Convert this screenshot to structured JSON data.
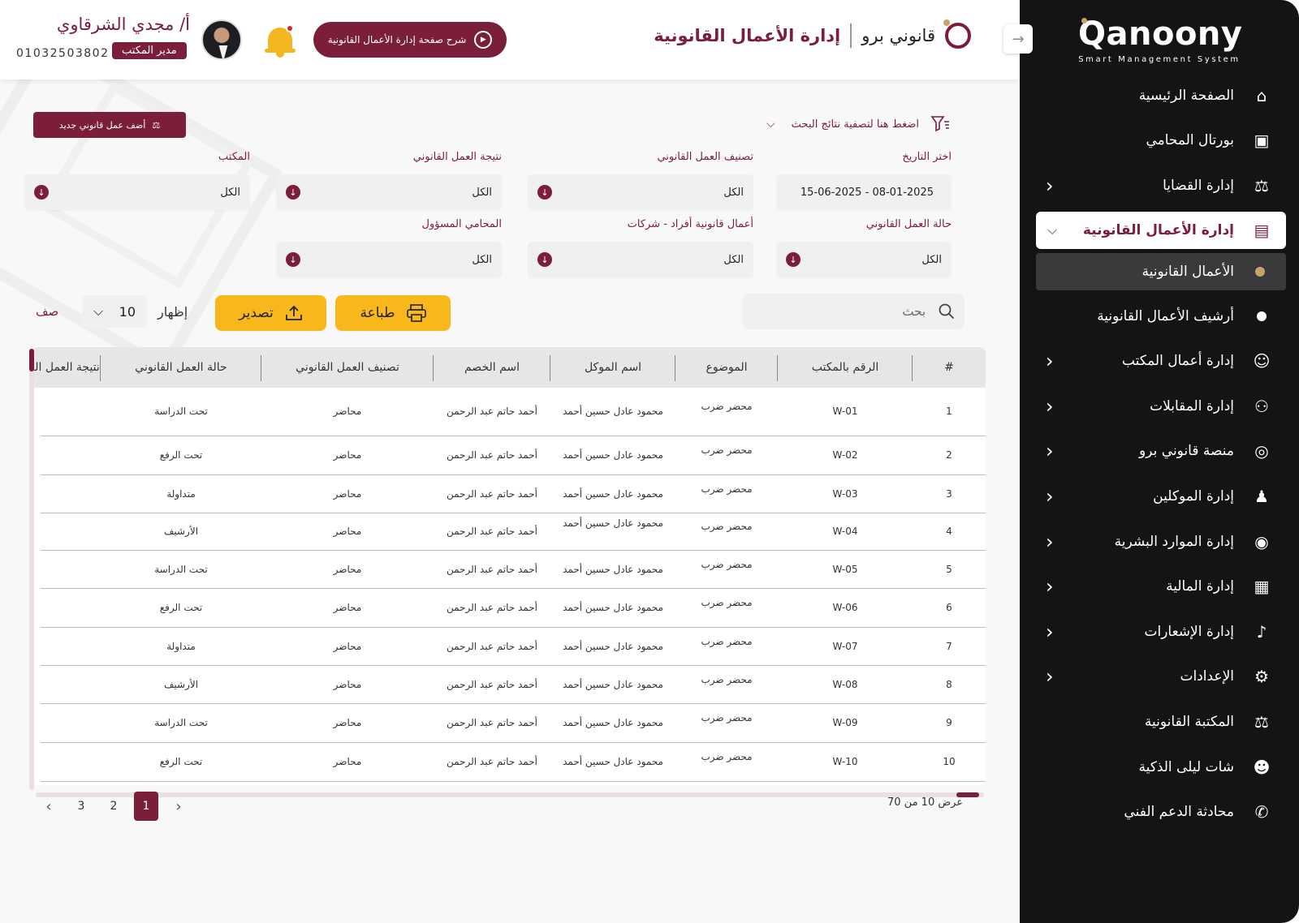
{
  "brand": {
    "logo": "Qanoony",
    "subtitle": "Smart Management System"
  },
  "header": {
    "app_name": "قانوني برو",
    "page_title": "إدارة الأعمال القانونية",
    "explain_button": "شرح صفحة إدارة الأعمال القانونية",
    "user_name": "أ/ مجدي الشرقاوي",
    "user_role": "مدير المكتب",
    "user_phone": "01032503802"
  },
  "sidebar": {
    "items": [
      {
        "label": "الصفحة الرئيسية",
        "icon": "home-icon",
        "glyph": "⌂"
      },
      {
        "label": "بورتال المحامي",
        "icon": "briefcase-icon",
        "glyph": "▣"
      },
      {
        "label": "إدارة القضايا",
        "icon": "scales-icon",
        "glyph": "⚖"
      },
      {
        "label": "إدارة الأعمال القانونية",
        "icon": "legal-docs-icon",
        "glyph": "▤"
      },
      {
        "label": "الأعمال القانونية",
        "icon": "bullet-icon"
      },
      {
        "label": "أرشيف الأعمال القانونية",
        "icon": "bullet-icon"
      },
      {
        "label": "إدارة أعمال المكتب",
        "icon": "office-icon",
        "glyph": "☺"
      },
      {
        "label": "إدارة المقابلات",
        "icon": "meetings-icon",
        "glyph": "⚇"
      },
      {
        "label": "منصة قانوني برو",
        "icon": "platform-icon",
        "glyph": "◎"
      },
      {
        "label": "إدارة الموكلين",
        "icon": "client-icon",
        "glyph": "♟"
      },
      {
        "label": "إدارة الموارد البشرية",
        "icon": "hr-icon",
        "glyph": "◉"
      },
      {
        "label": "إدارة المالية",
        "icon": "finance-icon",
        "glyph": "▦"
      },
      {
        "label": "إدارة الإشعارات",
        "icon": "bell-icon",
        "glyph": "♪"
      },
      {
        "label": "الإعدادات",
        "icon": "gear-icon",
        "glyph": "⚙"
      },
      {
        "label": "المكتبة القانونية",
        "icon": "library-icon",
        "glyph": "⚖"
      },
      {
        "label": "شات ليلى الذكية",
        "icon": "ai-chat-icon",
        "glyph": "☻"
      },
      {
        "label": "محادثة الدعم الفني",
        "icon": "support-icon",
        "glyph": "✆"
      }
    ]
  },
  "toolbar": {
    "add_button": "أضف عمل قانوني جديد",
    "filter_toggle": "اضغط هنا لتصفية نتائج البحث"
  },
  "filters": {
    "date_label": "اختر التاريخ",
    "date_value": "08-01-2025 - 15-06-2025",
    "classification_label": "تصنيف العمل القانوني",
    "classification_value": "الكل",
    "result_label": "نتيجة العمل القانوني",
    "result_value": "الكل",
    "office_label": "المكتب",
    "office_value": "الكل",
    "status_label": "حالة العمل القانوني",
    "status_value": "الكل",
    "type_label": "أعمال قانونية أفراد - شركات",
    "type_value": "الكل",
    "lawyer_label": "المحامي المسؤول",
    "lawyer_value": "الكل"
  },
  "actions": {
    "search_placeholder": "بحث",
    "print": "طباعة",
    "export": "تصدير",
    "show_label": "إظهار",
    "page_size": "10",
    "rows_label": "صف"
  },
  "table": {
    "headers": [
      "#",
      "الرقم بالمكتب",
      "الموضوع",
      "اسم الموكل",
      "اسم الخصم",
      "تصنيف العمل القانوني",
      "حالة العمل القانوني",
      "نتيجة العمل القانوني"
    ],
    "rows": [
      [
        "1",
        "W-01",
        "محضر ضرب",
        "محمود عادل حسين أحمد",
        "أحمد حاتم عبد الرحمن",
        "محاضر",
        "تحت الدراسة"
      ],
      [
        "2",
        "W-02",
        "محضر ضرب",
        "محمود عادل حسين أحمد",
        "أحمد حاتم عبد الرحمن",
        "محاضر",
        "تحت الرفع"
      ],
      [
        "3",
        "W-03",
        "محضر ضرب",
        "محمود عادل حسين أحمد",
        "أحمد حاتم عبد الرحمن",
        "محاضر",
        "متداولة"
      ],
      [
        "4",
        "W-04",
        "محضر ضرب",
        "محمود عادل حسين أحمد",
        "أحمد حاتم عبد الرحمن",
        "محاضر",
        "الأرشيف"
      ],
      [
        "5",
        "W-05",
        "محضر ضرب",
        "محمود عادل حسين أحمد",
        "أحمد حاتم عبد الرحمن",
        "محاضر",
        "تحت الدراسة"
      ],
      [
        "6",
        "W-06",
        "محضر ضرب",
        "محمود عادل حسين أحمد",
        "أحمد حاتم عبد الرحمن",
        "محاضر",
        "تحت الرفع"
      ],
      [
        "7",
        "W-07",
        "محضر ضرب",
        "محمود عادل حسين أحمد",
        "أحمد حاتم عبد الرحمن",
        "محاضر",
        "متداولة"
      ],
      [
        "8",
        "W-08",
        "محضر ضرب",
        "محمود عادل حسين أحمد",
        "أحمد حاتم عبد الرحمن",
        "محاضر",
        "الأرشيف"
      ],
      [
        "9",
        "W-09",
        "محضر ضرب",
        "محمود عادل حسين أحمد",
        "أحمد حاتم عبد الرحمن",
        "محاضر",
        "تحت الدراسة"
      ],
      [
        "10",
        "W-10",
        "محضر ضرب",
        "محمود عادل حسين أحمد",
        "أحمد حاتم عبد الرحمن",
        "محاضر",
        "تحت الرفع"
      ]
    ]
  },
  "pagination": {
    "summary": "عرض 10 من 70",
    "pages": [
      "1",
      "2",
      "3"
    ],
    "current": "1"
  },
  "colors": {
    "primary": "#7a1e3a",
    "accent": "#f8b81c",
    "sidebar": "#141414",
    "gold": "#c9a46a"
  }
}
